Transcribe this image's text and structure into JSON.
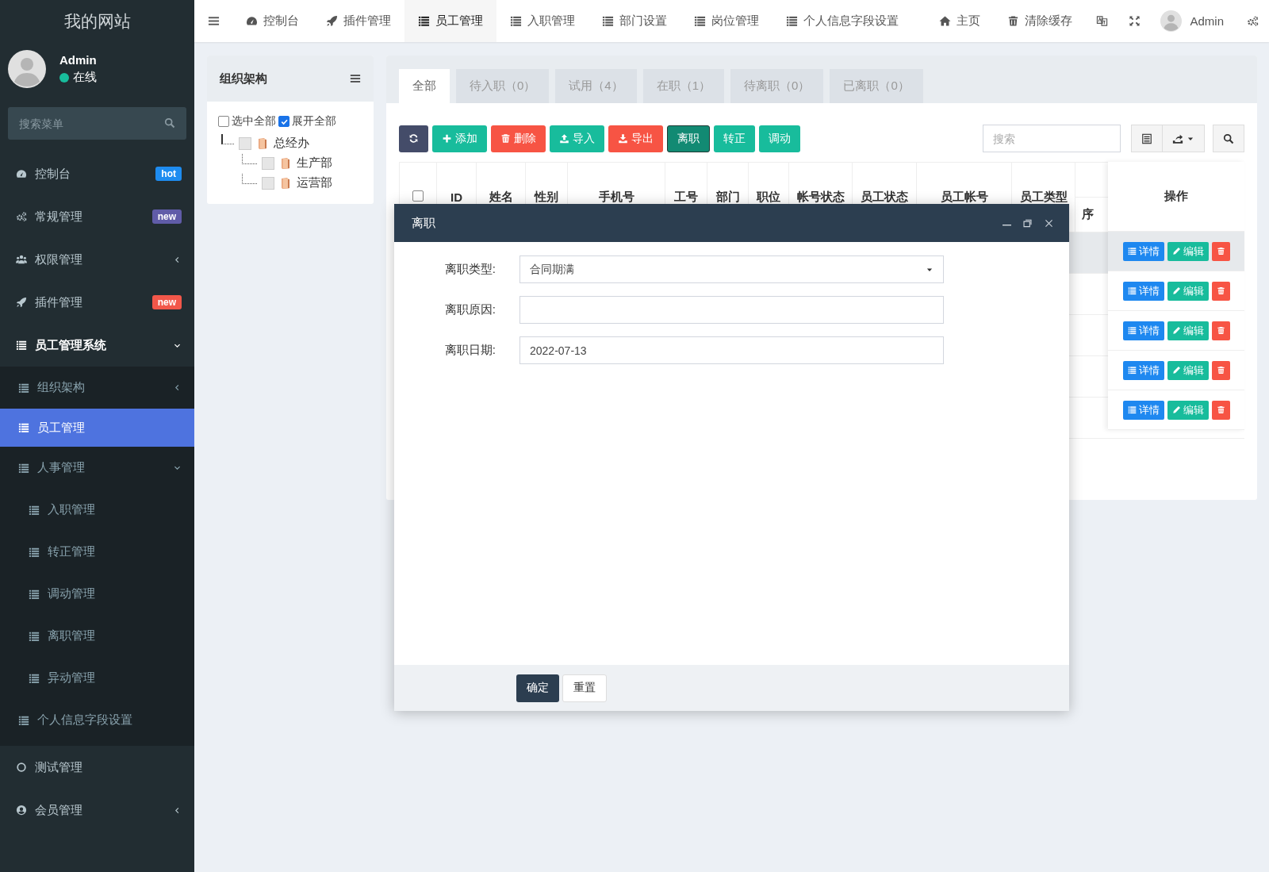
{
  "sidebar": {
    "logo": "我的网站",
    "user": {
      "name": "Admin",
      "status": "在线",
      "online": true
    },
    "search": {
      "placeholder": "搜索菜单"
    },
    "menu": [
      {
        "label": "控制台",
        "badge": {
          "text": "hot",
          "color": "#1e8cf0"
        },
        "selected": false
      },
      {
        "label": "常规管理",
        "badge": {
          "text": "new",
          "color": "#605ca8"
        },
        "selected": false
      },
      {
        "label": "权限管理",
        "expanded": false,
        "selected": false
      },
      {
        "label": "插件管理",
        "badge": {
          "text": "new",
          "color": "#f2574a"
        },
        "selected": false
      },
      {
        "label": "员工管理系统",
        "expanded": true,
        "selected": false,
        "children": [
          {
            "label": "组织架构",
            "expanded": false,
            "selected": false
          },
          {
            "label": "员工管理",
            "selected": true
          },
          {
            "label": "人事管理",
            "expanded": true,
            "selected": false,
            "children": [
              {
                "label": "入职管理",
                "selected": false
              },
              {
                "label": "转正管理",
                "selected": false
              },
              {
                "label": "调动管理",
                "selected": false
              },
              {
                "label": "离职管理",
                "selected": false
              },
              {
                "label": "异动管理",
                "selected": false
              }
            ]
          },
          {
            "label": "个人信息字段设置",
            "selected": false
          }
        ]
      },
      {
        "label": "测试管理",
        "selected": false
      },
      {
        "label": "会员管理",
        "expanded": false,
        "selected": false
      }
    ]
  },
  "nav": {
    "tabs": [
      {
        "label": "控制台",
        "selected": false
      },
      {
        "label": "插件管理",
        "selected": false
      },
      {
        "label": "员工管理",
        "selected": true
      },
      {
        "label": "入职管理",
        "selected": false
      },
      {
        "label": "部门设置",
        "selected": false
      },
      {
        "label": "岗位管理",
        "selected": false
      },
      {
        "label": "个人信息字段设置",
        "selected": false
      }
    ],
    "links": [
      "主页",
      "清除缓存"
    ],
    "user": {
      "name": "Admin"
    }
  },
  "org_panel": {
    "title": "组织架构",
    "select_all": {
      "label": "选中全部",
      "checked": false
    },
    "expand_all": {
      "label": "展开全部",
      "checked": true
    },
    "tree": [
      {
        "label": "总经办",
        "checked": false,
        "children": [
          {
            "label": "生产部",
            "checked": false
          },
          {
            "label": "运营部",
            "checked": false
          }
        ]
      }
    ]
  },
  "main": {
    "tabs": [
      {
        "label": "全部",
        "selected": true
      },
      {
        "label": "待入职（0）",
        "selected": false
      },
      {
        "label": "试用（4）",
        "selected": false
      },
      {
        "label": "在职（1）",
        "selected": false
      },
      {
        "label": "待离职（0）",
        "selected": false
      },
      {
        "label": "已离职（0）",
        "selected": false
      }
    ],
    "toolbar": [
      {
        "kind": "primary",
        "active": false
      },
      {
        "label": "添加",
        "kind": "success",
        "active": false
      },
      {
        "label": "删除",
        "kind": "danger",
        "active": false
      },
      {
        "label": "导入",
        "kind": "success",
        "active": false
      },
      {
        "label": "导出",
        "kind": "danger",
        "active": false
      },
      {
        "label": "离职",
        "kind": "success",
        "active": true
      },
      {
        "label": "转正",
        "kind": "success",
        "active": false
      },
      {
        "label": "调动",
        "kind": "success",
        "active": false
      }
    ],
    "search": {
      "placeholder": "搜索"
    },
    "table": {
      "header_checkbox": {
        "checked": false
      },
      "columns": [
        "ID",
        "姓名",
        "性别",
        "手机号",
        "工号",
        "部门",
        "职位",
        "帐号状态",
        "员工状态",
        "员工帐号",
        "员工类型"
      ],
      "subcolumns": [
        "序"
      ],
      "action_column": "操作",
      "rows": [
        {
          "highlighted": true,
          "actions": [
            {
              "label": "详情",
              "kind": "info"
            },
            {
              "label": "编辑",
              "kind": "success"
            },
            {
              "kind": "danger"
            }
          ]
        },
        {
          "highlighted": false,
          "actions": [
            {
              "label": "详情",
              "kind": "info"
            },
            {
              "label": "编辑",
              "kind": "success"
            },
            {
              "kind": "danger"
            }
          ]
        },
        {
          "highlighted": false,
          "actions": [
            {
              "label": "详情",
              "kind": "info"
            },
            {
              "label": "编辑",
              "kind": "success"
            },
            {
              "kind": "danger"
            }
          ]
        },
        {
          "highlighted": false,
          "actions": [
            {
              "label": "详情",
              "kind": "info"
            },
            {
              "label": "编辑",
              "kind": "success"
            },
            {
              "kind": "danger"
            }
          ]
        },
        {
          "highlighted": false,
          "actions": [
            {
              "label": "详情",
              "kind": "info"
            },
            {
              "label": "编辑",
              "kind": "success"
            },
            {
              "kind": "danger"
            }
          ]
        }
      ]
    }
  },
  "modal": {
    "title": "离职",
    "fields": [
      {
        "label": "离职类型:",
        "kind": "select",
        "value": "合同期满"
      },
      {
        "label": "离职原因:",
        "kind": "text"
      },
      {
        "label": "离职日期:",
        "kind": "text",
        "value": "2022-07-13"
      }
    ],
    "buttons": [
      {
        "label": "确定",
        "kind": "primary"
      },
      {
        "label": "重置",
        "kind": "default"
      }
    ]
  }
}
